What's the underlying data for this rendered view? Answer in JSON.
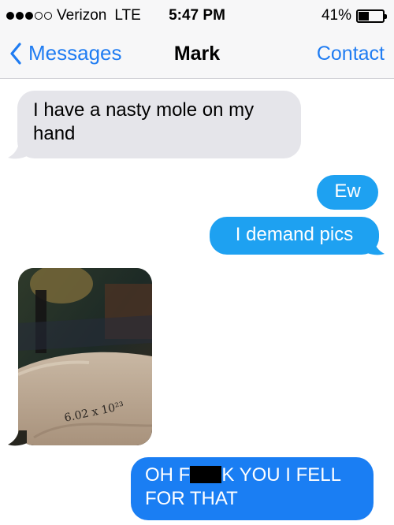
{
  "status_bar": {
    "carrier": "Verizon",
    "network": "LTE",
    "time": "5:47 PM",
    "battery_percent": "41%",
    "battery_level": 0.41,
    "signal_filled": 3,
    "signal_total": 5
  },
  "nav": {
    "back_label": "Messages",
    "title": "Mark",
    "action_label": "Contact"
  },
  "messages": [
    {
      "side": "incoming",
      "text": "I have a nasty mole on my hand"
    },
    {
      "side": "outgoing",
      "text": "Ew"
    },
    {
      "side": "outgoing",
      "text": "I demand pics"
    },
    {
      "side": "incoming",
      "type": "photo",
      "handwriting": "6.02 x 10²³"
    },
    {
      "side": "outgoing",
      "text_before": "OH F",
      "redacted": true,
      "text_after": "K YOU I FELL FOR THAT"
    }
  ],
  "colors": {
    "ios_blue": "#1f7cf2",
    "incoming_bubble": "#e5e5ea",
    "outgoing_bubble": "#1ea1f1",
    "outgoing_bubble_dark": "#1a7ef3",
    "bar_background": "#f7f7f8"
  },
  "icons": {
    "back": "chevron-left-icon",
    "battery": "battery-icon",
    "signal": "signal-dots-icon"
  }
}
